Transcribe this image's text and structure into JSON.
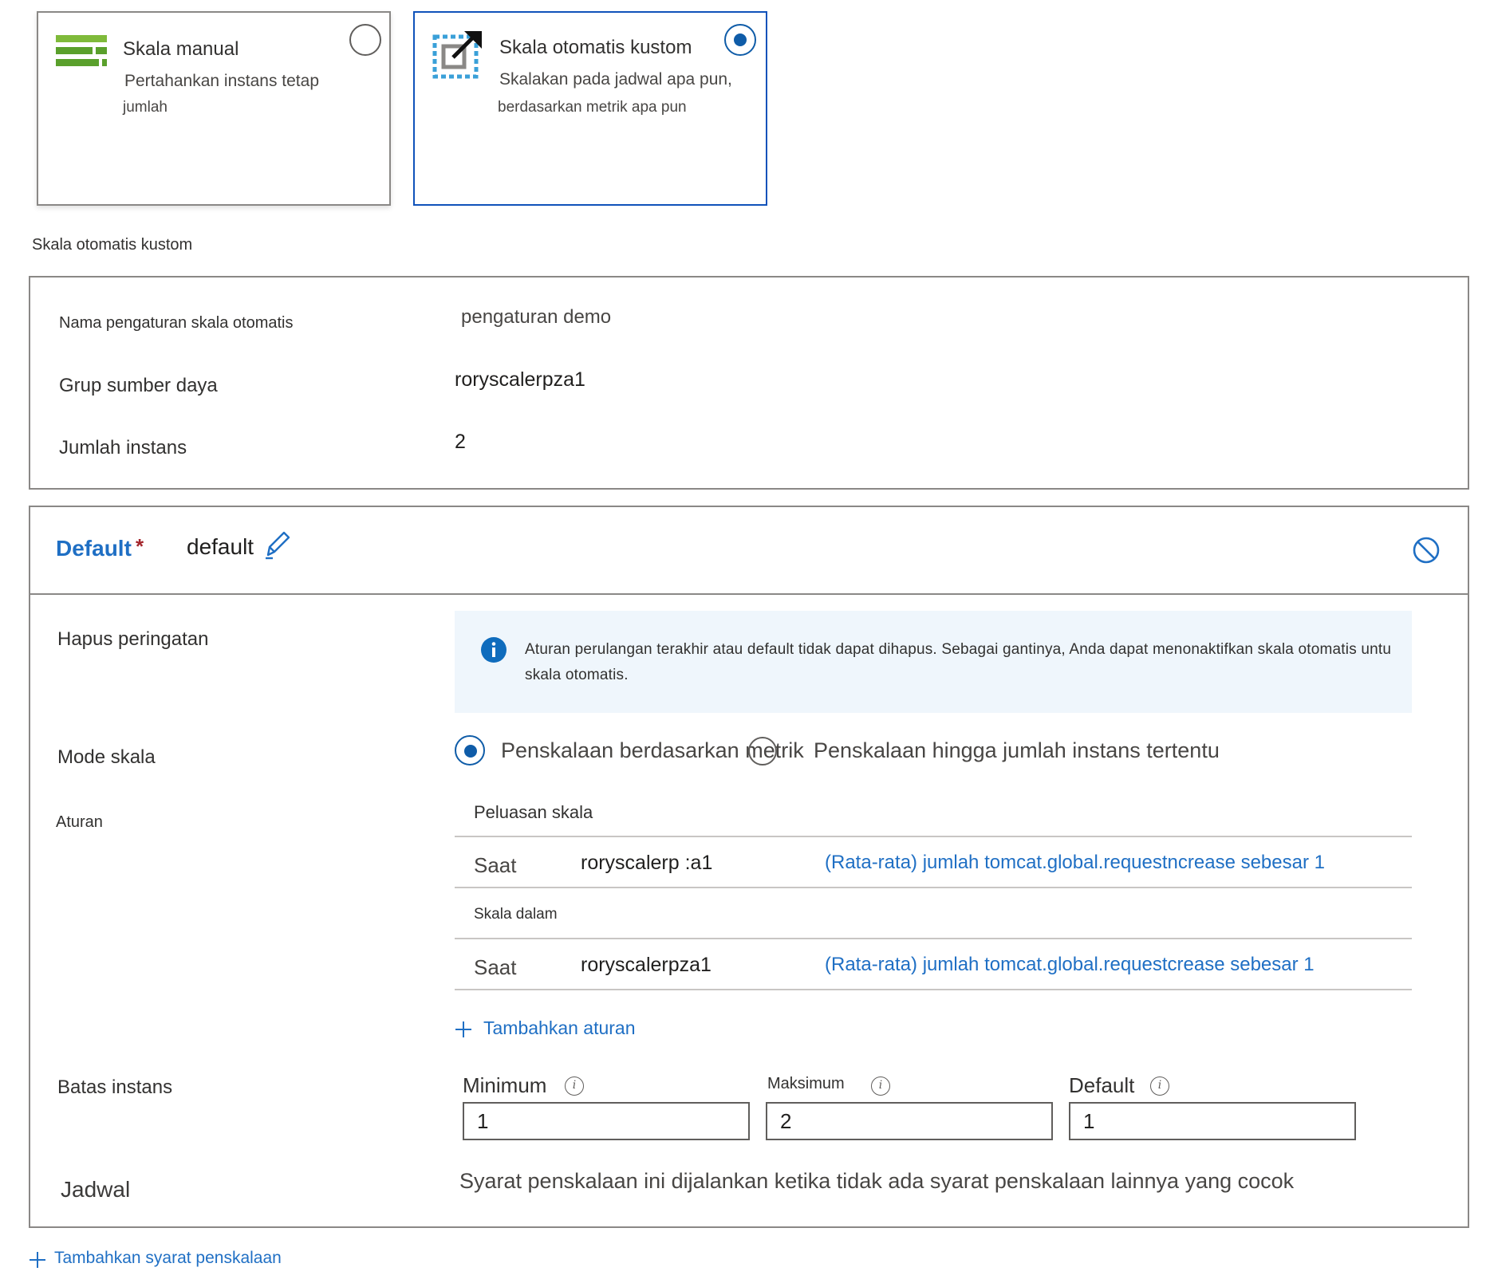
{
  "mode_cards": {
    "manual": {
      "title": "Skala manual",
      "desc_line1": "Pertahankan instans tetap",
      "desc_line2": "jumlah",
      "selected": false
    },
    "custom_autoscale": {
      "title": "Skala otomatis kustom",
      "desc_line1": "Skalakan pada jadwal apa pun,",
      "desc_line2": "berdasarkan metrik apa pun",
      "selected": true
    }
  },
  "section_heading": "Skala otomatis kustom",
  "settings": {
    "name_label": "Nama pengaturan skala otomatis",
    "name_value": "pengaturan demo",
    "resource_group_label": "Grup sumber daya",
    "resource_group_value": "roryscalerpza1",
    "instance_count_label": "Jumlah instans",
    "instance_count_value": "2"
  },
  "condition": {
    "title": "Default",
    "required_mark": "*",
    "name": "default",
    "delete_warning_label": "Hapus peringatan",
    "info_line1": "Aturan perulangan terakhir atau default tidak dapat dihapus. Sebagai gantinya, Anda dapat menonaktifkan skala otomatis untu",
    "info_line2": "skala otomatis.",
    "scale_mode_label": "Mode skala",
    "scale_mode_options": [
      "Penskalaan berdasarkan metrik",
      "Penskalaan hingga jumlah instans tertentu"
    ],
    "rules_label": "Aturan",
    "scale_out_heading": "Peluasan skala",
    "scale_out_rule": {
      "when": "Saat",
      "resource": "roryscalerp :a1",
      "description": "(Rata-rata) jumlah tomcat.global.requestncrease sebesar 1"
    },
    "scale_in_heading": "Skala dalam",
    "scale_in_rule": {
      "when": "Saat",
      "resource": "roryscalerpza1",
      "description": "(Rata-rata) jumlah tomcat.global.requestcrease sebesar 1"
    },
    "add_rule": "Tambahkan aturan",
    "instance_limits_label": "Batas instans",
    "minimum_label": "Minimum",
    "minimum_value": "1",
    "maximum_label": "Maksimum",
    "maximum_value": "2",
    "default_label": "Default",
    "default_value": "1",
    "schedule_label": "Jadwal",
    "schedule_text": "Syarat penskalaan ini dijalankan ketika tidak ada syarat penskalaan lainnya yang cocok"
  },
  "add_condition": "Tambahkan syarat penskalaan",
  "colors": {
    "accent": "#1f6fc4",
    "manual_icon_green": "#5aa02c",
    "info_background": "#eff6fc",
    "required_red": "#a4262c"
  }
}
